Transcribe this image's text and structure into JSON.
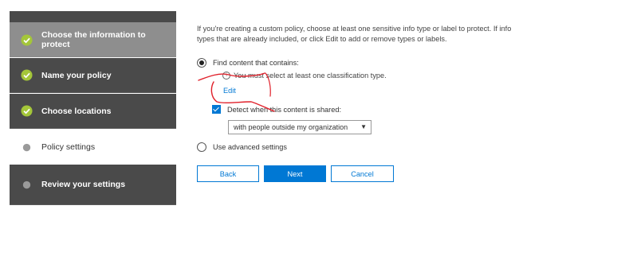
{
  "sidebar": {
    "steps": [
      {
        "label": "Choose the information to protect",
        "state": "completed",
        "icon": "check-circle-icon"
      },
      {
        "label": "Name your policy",
        "state": "completed",
        "icon": "check-circle-icon"
      },
      {
        "label": "Choose locations",
        "state": "completed",
        "icon": "check-circle-icon"
      },
      {
        "label": "Policy settings",
        "state": "current",
        "icon": "dot-icon"
      },
      {
        "label": "Review your settings",
        "state": "upcoming",
        "icon": "dot-icon"
      }
    ]
  },
  "main": {
    "description": "If you're creating a custom policy, choose at least one sensitive info type or label to protect. If info types that are already included, or click Edit to add or remove types or labels.",
    "option_find": {
      "label": "Find content that contains:",
      "selected": true
    },
    "validation_message": "You must select at least one classification type.",
    "edit_link": "Edit",
    "detect_checkbox": {
      "label": "Detect when this content is shared:",
      "checked": true
    },
    "share_scope_select": {
      "value": "with people outside my organization"
    },
    "option_advanced": {
      "label": "Use advanced settings",
      "selected": false
    }
  },
  "buttons": {
    "back": "Back",
    "next": "Next",
    "cancel": "Cancel"
  },
  "colors": {
    "accent": "#0078d4",
    "sidebar_dark": "#4a4a4a",
    "sidebar_active": "#8e8e8e",
    "check_green": "#a4c639",
    "annotation_red": "#e0202a"
  }
}
